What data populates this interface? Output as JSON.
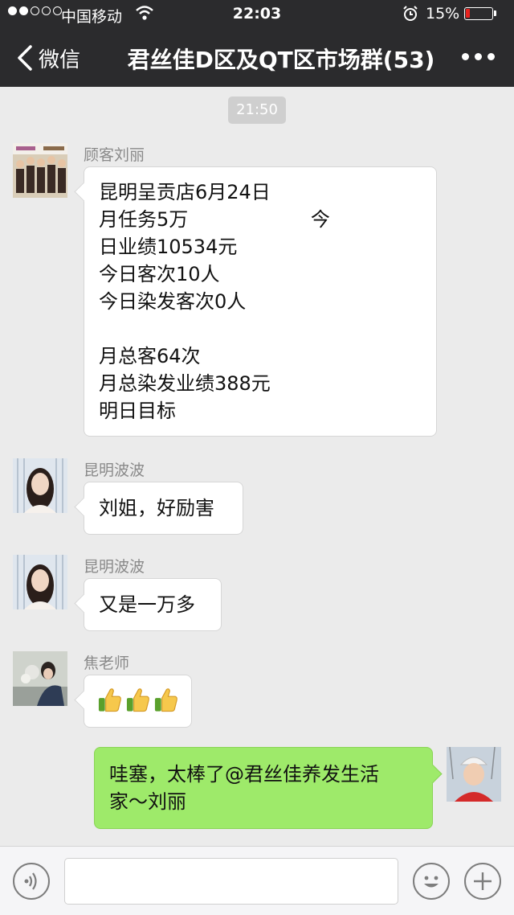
{
  "status_bar": {
    "carrier": "中国移动",
    "time": "22:03",
    "battery_percent": "15%",
    "battery_level": 0.15,
    "signal_bars": 2,
    "battery_color": "#e8221e"
  },
  "nav": {
    "back_label": "微信",
    "title": "君丝佳D区及QT区市场群(53)",
    "more_icon": "more-dots-icon"
  },
  "timestamp": "21:50",
  "messages": [
    {
      "sender": "顾客刘丽",
      "lines": [
        "昆明呈贡店6月24日",
        "月任务5万                    今",
        "日业绩10534元",
        "今日客次10人",
        "今日染发客次0人",
        "",
        "月总客64次",
        "月总染发业绩388元",
        "明日目标"
      ]
    },
    {
      "sender": "昆明波波",
      "text": "刘姐，好励害"
    },
    {
      "sender": "昆明波波",
      "text": "又是一万多"
    },
    {
      "sender": "焦老师",
      "content_icon": "thumbs-up-icon",
      "icon_count": 3
    },
    {
      "sender": "me",
      "lines": [
        "哇塞，太棒了@君丝佳养发生活",
        "家～刘丽"
      ]
    }
  ],
  "input_bar": {
    "voice_icon": "voice-icon",
    "emoji_icon": "emoji-icon",
    "plus_icon": "plus-icon",
    "input_value": ""
  },
  "colors": {
    "bar_bg": "#2b2b2d",
    "chat_bg": "#ebebeb",
    "my_bubble": "#9eea6a"
  }
}
